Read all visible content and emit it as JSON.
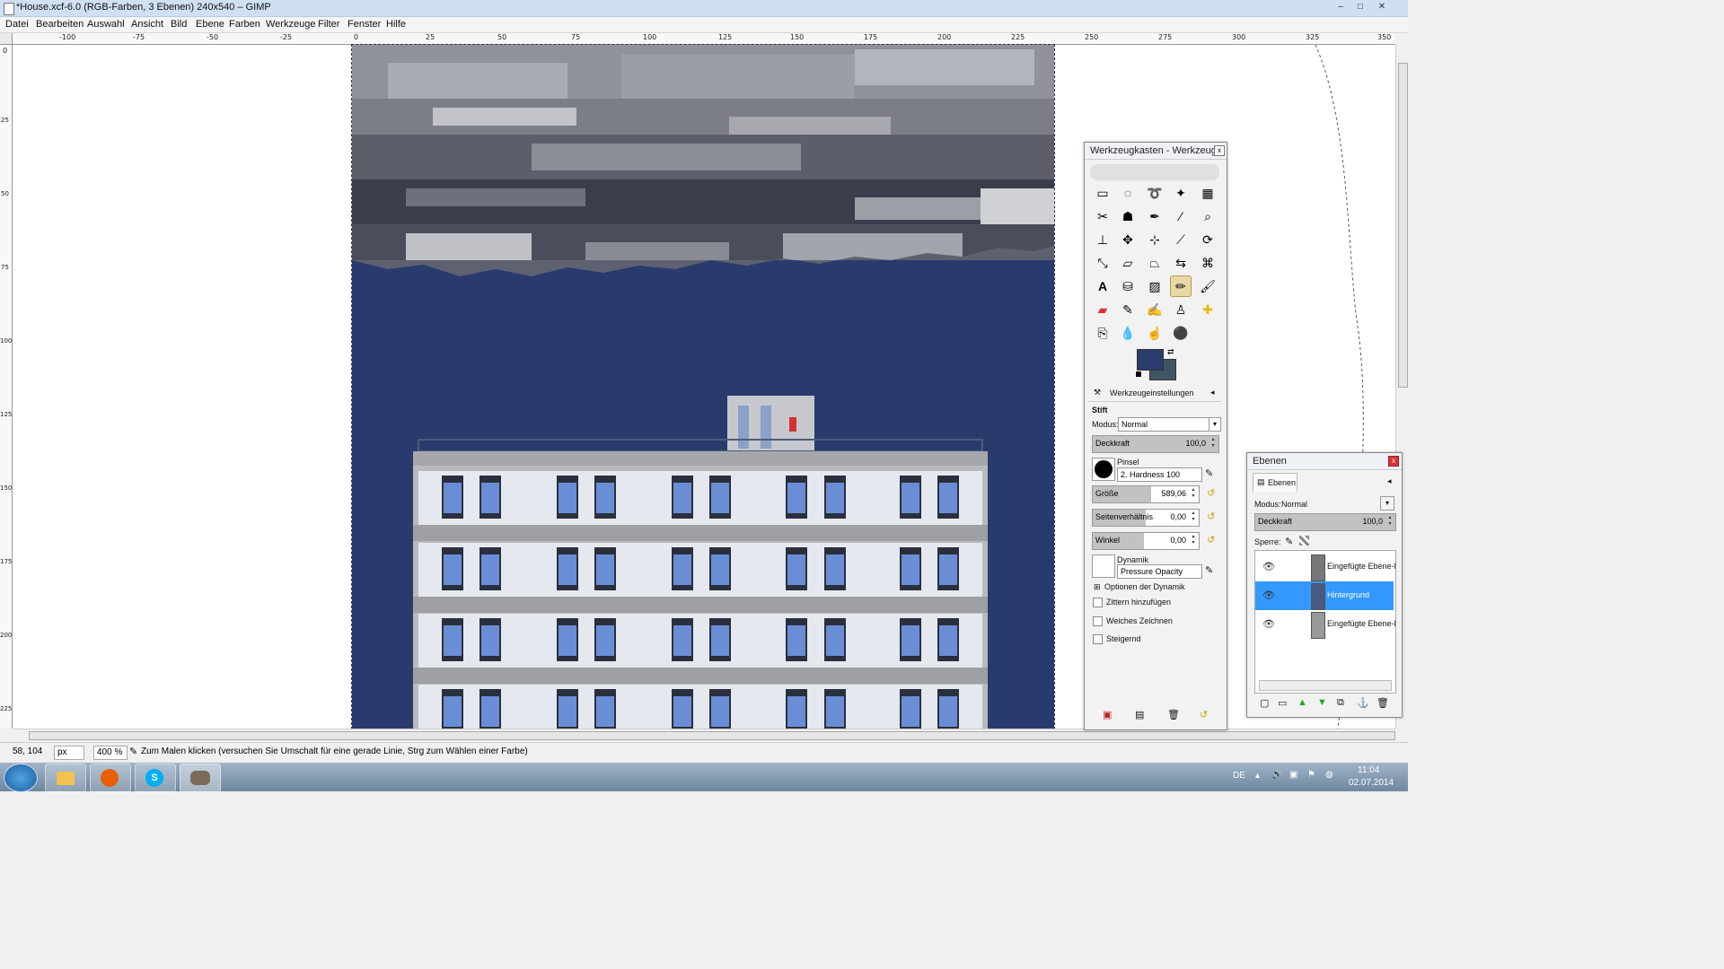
{
  "window": {
    "title": "*House.xcf-6.0 (RGB-Farben, 3 Ebenen) 240x540 – GIMP",
    "controls": [
      "–",
      "□",
      "✕"
    ]
  },
  "menu": [
    "Datei",
    "Bearbeiten",
    "Auswahl",
    "Ansicht",
    "Bild",
    "Ebene",
    "Farben",
    "Werkzeuge",
    "Filter",
    "Fenster",
    "Hilfe"
  ],
  "ruler": {
    "h_ticks": [
      "-100",
      "-75",
      "-50",
      "-25",
      "0",
      "25",
      "50",
      "75",
      "100",
      "125",
      "150",
      "175",
      "200",
      "225",
      "250",
      "275",
      "300",
      "325",
      "350"
    ],
    "v_ticks": [
      "0",
      "25",
      "50",
      "75",
      "100",
      "125",
      "150",
      "175",
      "200",
      "225"
    ]
  },
  "statusbar": {
    "coords": "58, 104",
    "unit": "px",
    "zoom": "400 %",
    "message": "Zum Malen klicken (versuchen Sie Umschalt für eine gerade Linie, Strg zum Wählen einer Farbe)"
  },
  "toolbox": {
    "title": "Werkzeugkasten - Werkzeug...",
    "close": "x",
    "fg_color": "#2b3c6e",
    "bg_color": "#3d5564",
    "options_tab": "Werkzeugeinstellungen",
    "tool_name": "Stift",
    "mode_label": "Modus:",
    "mode_value": "Normal",
    "opacity_label": "Deckkraft",
    "opacity_value": "100,0",
    "brush_label": "Pinsel",
    "brush_value": "2. Hardness 100",
    "size_label": "Größe",
    "size_value": "589,06",
    "aspect_label": "Seitenverhältnis",
    "aspect_value": "0,00",
    "angle_label": "Winkel",
    "angle_value": "0,00",
    "dynamics_label": "Dynamik",
    "dynamics_value": "Pressure Opacity",
    "dynamics_options": "Optionen der Dynamik",
    "jitter": "Zittern hinzufügen",
    "smooth": "Weiches Zeichnen",
    "incremental": "Steigernd"
  },
  "layers": {
    "title": "Ebenen",
    "close": "x",
    "tab": "Ebenen",
    "mode_label": "Modus:",
    "mode_value": "Normal",
    "opacity_label": "Deckkraft",
    "opacity_value": "100,0",
    "lock_label": "Sperre:",
    "items": [
      {
        "name": "Eingefügte Ebene-Ko"
      },
      {
        "name": "Hintergrund"
      },
      {
        "name": "Eingefügte Ebene-Ko"
      }
    ]
  },
  "taskbar": {
    "lang": "DE",
    "time": "11:04",
    "date": "02.07.2014"
  }
}
